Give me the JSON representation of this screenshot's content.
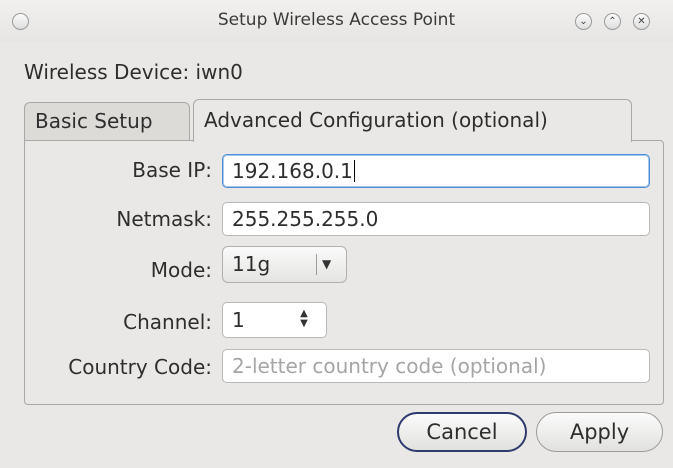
{
  "window": {
    "title": "Setup Wireless Access Point",
    "icons": [
      "menu-icon",
      "minimize-icon",
      "maximize-icon",
      "close-icon"
    ]
  },
  "device": {
    "label": "Wireless Device: iwn0"
  },
  "tabs": [
    {
      "label": "Basic Setup",
      "active": false
    },
    {
      "label": "Advanced Configuration (optional)",
      "active": true
    }
  ],
  "form": {
    "base_ip": {
      "label": "Base IP:",
      "value": "192.168.0.1"
    },
    "netmask": {
      "label": "Netmask:",
      "value": "255.255.255.0"
    },
    "mode": {
      "label": "Mode:",
      "value": "11g"
    },
    "channel": {
      "label": "Channel:",
      "value": "1"
    },
    "country_code": {
      "label": "Country Code:",
      "value": "",
      "placeholder": "2-letter country code (optional)"
    }
  },
  "buttons": {
    "cancel": "Cancel",
    "apply": "Apply"
  },
  "colors": {
    "focus_border": "#4a90d9",
    "default_button_border": "#2f3a6e"
  }
}
